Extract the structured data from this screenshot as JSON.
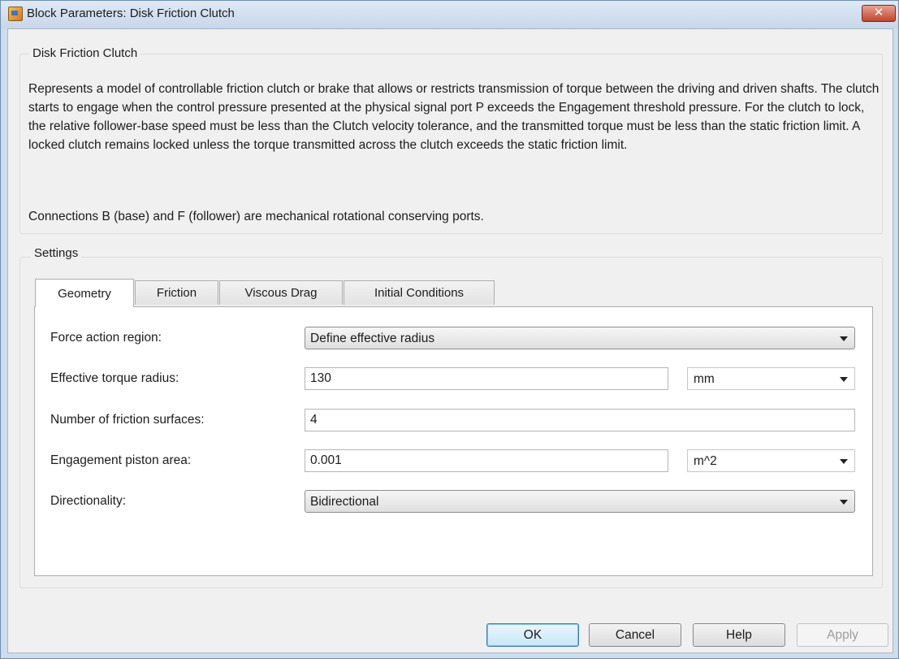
{
  "window": {
    "title": "Block Parameters: Disk Friction Clutch",
    "close_label": "✕"
  },
  "description_group": {
    "legend": "Disk Friction Clutch",
    "text": "Represents a model of controllable friction clutch or brake that allows or restricts transmission of torque between the driving and driven shafts. The clutch starts to engage when the control pressure presented at the physical signal port P exceeds the Engagement threshold pressure. For the clutch to lock, the relative follower-base speed must be less than the Clutch velocity tolerance, and the transmitted torque must be less than the static friction limit. A locked clutch remains locked unless the torque transmitted across the clutch exceeds the static friction limit.",
    "connections": "Connections B (base) and F (follower) are mechanical rotational conserving ports."
  },
  "settings": {
    "legend": "Settings",
    "tabs": [
      {
        "label": "Geometry",
        "active": true
      },
      {
        "label": "Friction",
        "active": false
      },
      {
        "label": "Viscous Drag",
        "active": false
      },
      {
        "label": "Initial Conditions",
        "active": false
      }
    ],
    "params": {
      "force_action_region": {
        "label": "Force action region:",
        "value": "Define effective radius"
      },
      "effective_torque_radius": {
        "label": "Effective torque radius:",
        "value": "130",
        "unit": "mm"
      },
      "number_of_friction_surfaces": {
        "label": "Number of friction surfaces:",
        "value": "4"
      },
      "engagement_piston_area": {
        "label": "Engagement piston area:",
        "value": "0.001",
        "unit": "m^2"
      },
      "directionality": {
        "label": "Directionality:",
        "value": "Bidirectional"
      }
    }
  },
  "buttons": {
    "ok": "OK",
    "cancel": "Cancel",
    "help": "Help",
    "apply": "Apply"
  }
}
